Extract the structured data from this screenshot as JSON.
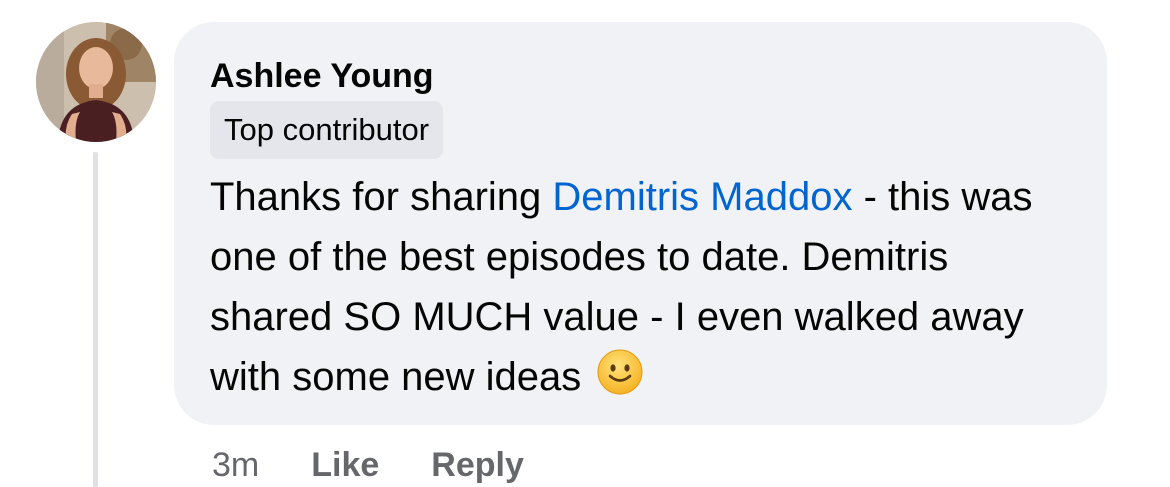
{
  "comment": {
    "author": "Ashlee Young",
    "badge": "Top contributor",
    "text_before_mention": "Thanks for sharing ",
    "mention": "Demitris Maddox",
    "text_after_mention": " - this was one of the best episodes to date. Demitris shared SO MUCH value - I even walked away with some new ideas ",
    "emoji": "slightly-smiling-face-icon"
  },
  "actions": {
    "timestamp": "3m",
    "like_label": "Like",
    "reply_label": "Reply"
  },
  "colors": {
    "bubble_bg": "#f0f2f5",
    "badge_bg": "#e4e6eb",
    "mention": "#0064d1",
    "meta_text": "#65676b",
    "thread_line": "#dfe1e5"
  }
}
